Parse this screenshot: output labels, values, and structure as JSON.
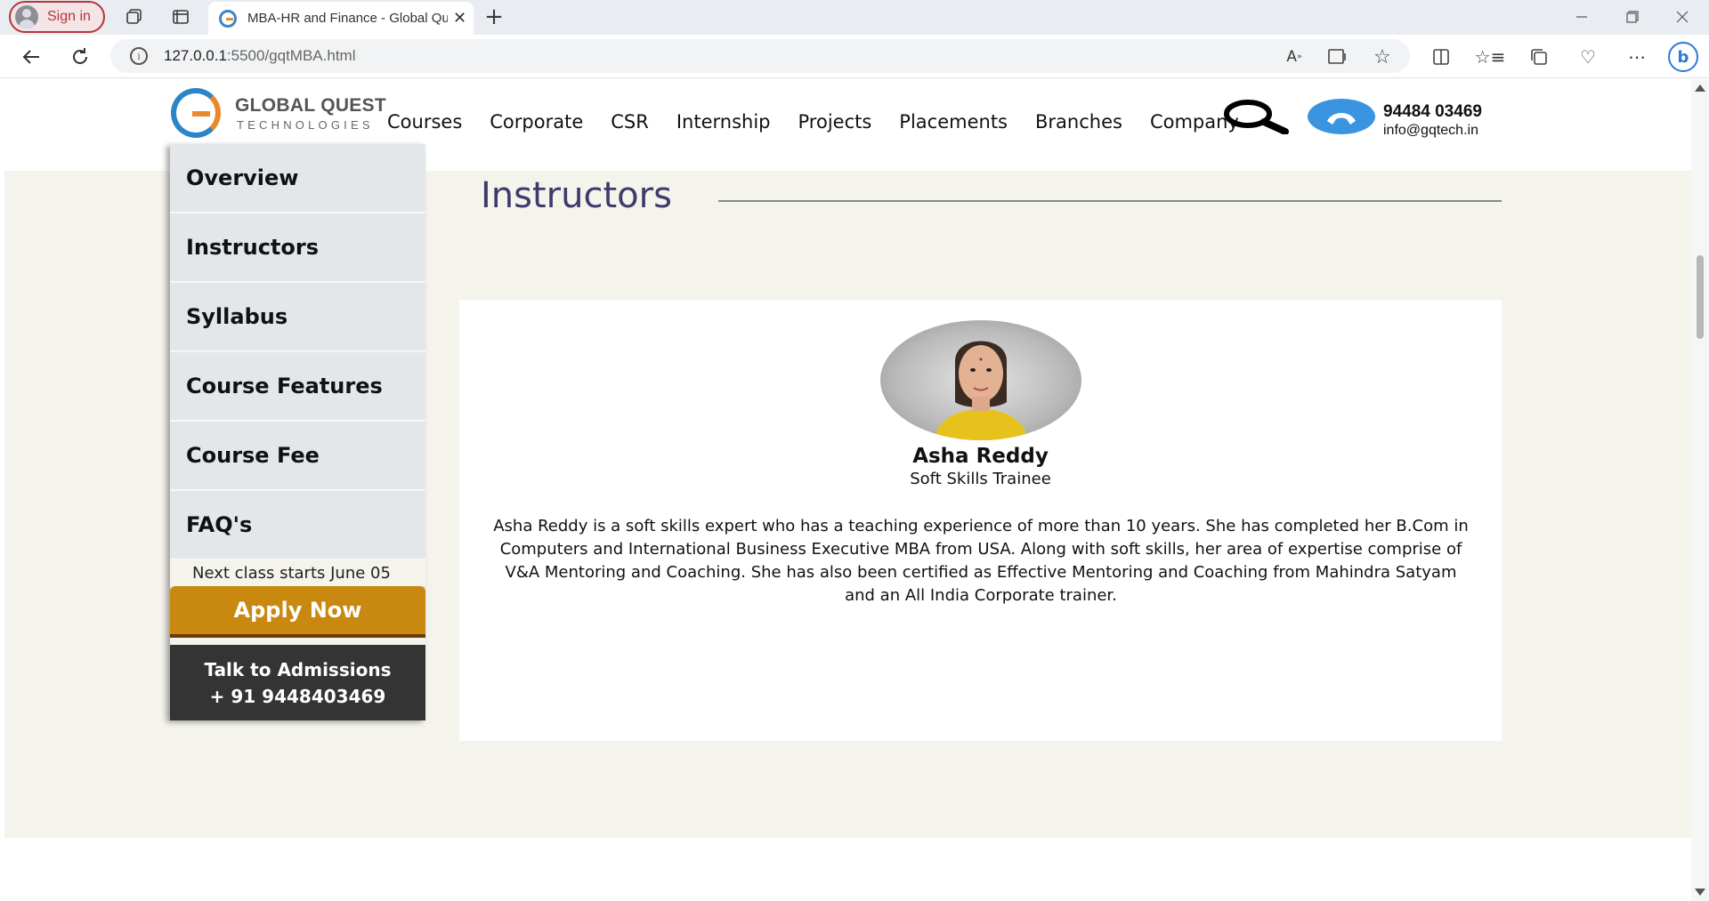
{
  "browser": {
    "signin_label": "Sign in",
    "tab_title": "MBA-HR and Finance - Global Quest Technologies",
    "url_host": "127.0.0.1",
    "url_rest": ":5500/gqtMBA.html"
  },
  "header": {
    "logo_line1": "GLOBAL QUEST",
    "logo_line2": "TECHNOLOGIES",
    "nav": [
      "Courses",
      "Corporate",
      "CSR",
      "Internship",
      "Projects",
      "Placements",
      "Branches",
      "Company"
    ],
    "phone": "94484 03469",
    "email": "info@gqtech.in"
  },
  "sidebar": {
    "items": [
      {
        "label": "Overview"
      },
      {
        "label": "Instructors"
      },
      {
        "label": "Syllabus"
      },
      {
        "label": "Course Features"
      },
      {
        "label": "Course Fee"
      },
      {
        "label": "FAQ's"
      }
    ],
    "next_class": "Next class starts June 05",
    "apply_label": "Apply Now",
    "talk_line1": "Talk to Admissions",
    "talk_line2": "+ 91 9448403469"
  },
  "main": {
    "section_title": "Instructors",
    "instructor": {
      "name": "Asha Reddy",
      "role": "Soft Skills Trainee",
      "bio": "Asha Reddy is a soft skills expert who has a teaching experience of more than 10 years. She has completed her B.Com in Computers and International Business Executive MBA from USA. Along with soft skills, her area of expertise comprise of V&A Mentoring and Coaching. She has also been certified as Effective Mentoring and Coaching from Mahindra Satyam and an All India Corporate trainer."
    }
  },
  "colors": {
    "accent_apply": "#c98810",
    "title_color": "#3e3a6b",
    "talk_bg": "#343434",
    "content_bg": "#f4f3ec"
  }
}
